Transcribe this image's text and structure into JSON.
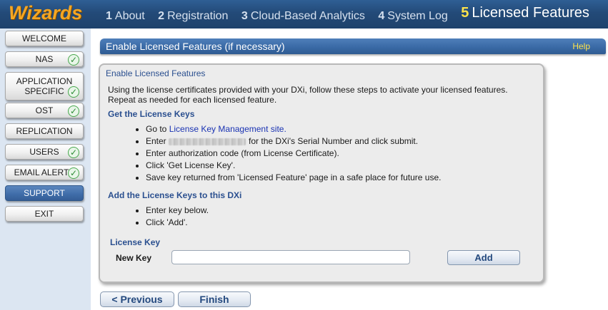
{
  "header": {
    "brand": "Wizards",
    "steps": [
      {
        "num": "1",
        "label": "About"
      },
      {
        "num": "2",
        "label": "Registration"
      },
      {
        "num": "3",
        "label": "Cloud-Based Analytics"
      },
      {
        "num": "4",
        "label": "System Log"
      },
      {
        "num": "5",
        "label": "Licensed Features"
      }
    ]
  },
  "sidebar": {
    "items": [
      {
        "label": "WELCOME",
        "done": false
      },
      {
        "label": "NAS",
        "done": true
      },
      {
        "label": "APPLICATION SPECIFIC",
        "done": true
      },
      {
        "label": "OST",
        "done": true
      },
      {
        "label": "REPLICATION",
        "done": false
      },
      {
        "label": "USERS",
        "done": true
      },
      {
        "label": "EMAIL ALERTS",
        "done": true
      },
      {
        "label": "SUPPORT",
        "done": false,
        "active": true
      },
      {
        "label": "EXIT",
        "done": false
      }
    ]
  },
  "titlebar": {
    "title": "Enable Licensed Features (if necessary)",
    "help": "Help"
  },
  "panel": {
    "title": "Enable Licensed Features",
    "intro_line1": "Using the license certificates provided with your DXi, follow these steps to activate your licensed features.",
    "intro_line2": "Repeat as needed for each licensed feature.",
    "section1": "Get the License Keys",
    "step1_pre": "Go to ",
    "step1_link": "License Key Management site.",
    "step2_pre": "Enter",
    "step2_post": "for the DXi's Serial Number and click submit.",
    "step3": "Enter authorization code (from License Certificate).",
    "step4": "Click 'Get License Key'.",
    "step5": "Save key returned from 'Licensed Feature' page in a safe place for future use.",
    "section2": "Add the License Keys to this DXi",
    "step6": "Enter key below.",
    "step7": "Click 'Add'.",
    "license_key_label": "License Key",
    "new_key_label": "New Key",
    "new_key_value": "",
    "add_label": "Add"
  },
  "footer": {
    "previous_label": "< Previous",
    "finish_label": "Finish"
  },
  "colors": {
    "header_bg": "#234a78",
    "brand": "#f5a623",
    "active_step": "#ffe34a",
    "sidebar_bg": "#dce6f2",
    "panel_heading": "#2a4f8f",
    "link": "#1a33b3",
    "check": "#2e8b36"
  }
}
